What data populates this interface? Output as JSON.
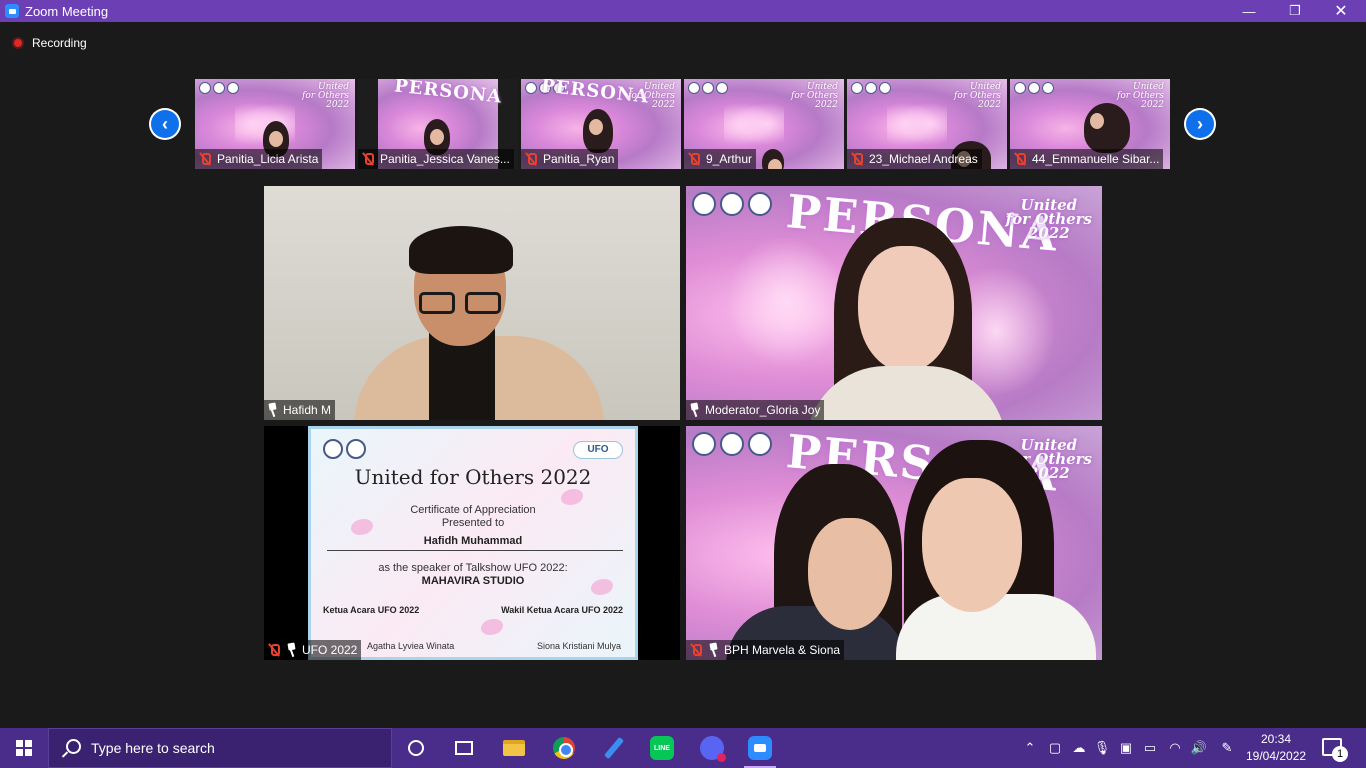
{
  "window": {
    "title": "Zoom Meeting",
    "minimize": "—",
    "maximize": "❐",
    "close": "✕"
  },
  "recording": {
    "label": "Recording"
  },
  "strip": {
    "participants": [
      {
        "name": "Panitia_Licia Arista",
        "muted": true
      },
      {
        "name": "Panitia_Jessica Vanes...",
        "muted": true
      },
      {
        "name": "Panitia_Ryan",
        "muted": true
      },
      {
        "name": "9_Arthur",
        "muted": true
      },
      {
        "name": "23_Michael Andreas",
        "muted": true
      },
      {
        "name": "44_Emmanuelle Sibar...",
        "muted": true
      }
    ]
  },
  "grid": {
    "tiles": [
      {
        "name": "Hafidh M",
        "muted": false,
        "pinned": true
      },
      {
        "name": "Moderator_Gloria Joy",
        "muted": false,
        "pinned": true
      },
      {
        "name": "UFO 2022",
        "muted": true,
        "pinned": true
      },
      {
        "name": "BPH Marvela & Siona",
        "muted": true,
        "pinned": true
      }
    ]
  },
  "background": {
    "persona": "PERSONA",
    "united_line1": "United",
    "united_line2": "for Others",
    "united_line3": "2022"
  },
  "certificate": {
    "title": "United for Others 2022",
    "line1": "Certificate of Appreciation",
    "line2": "Presented to",
    "recipient": "Hafidh Muhammad",
    "speaker_line": "as the speaker of Talkshow UFO 2022:",
    "studio": "MAHAVIRA STUDIO",
    "role_left": "Ketua Acara UFO 2022",
    "role_right": "Wakil Ketua Acara UFO 2022",
    "signer_left": "Agatha Lyviea Winata",
    "signer_right": "Siona Kristiani Mulya",
    "badge": "UFO"
  },
  "taskbar": {
    "search_placeholder": "Type here to search",
    "line_label": "LINE",
    "time": "20:34",
    "date": "19/04/2022",
    "notification_count": "1"
  },
  "colors": {
    "titlebar": "#6c3fb5",
    "taskbar": "#4a2d8a",
    "muted_red": "#e8412e",
    "nav_blue": "#0e71eb"
  }
}
